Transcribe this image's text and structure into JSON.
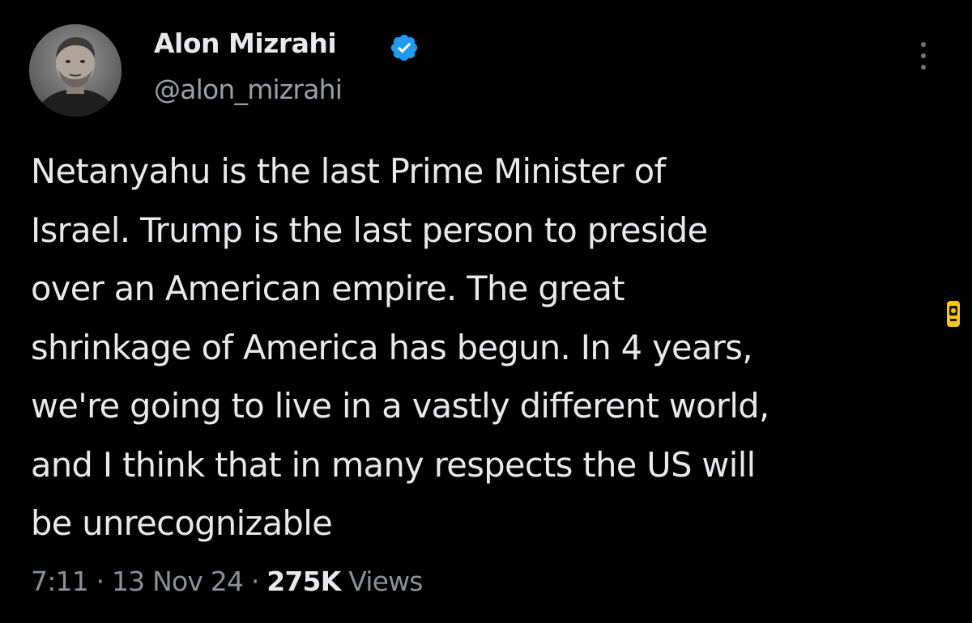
{
  "colors": {
    "background": "#000000",
    "text_primary": "#e7e9ea",
    "text_secondary": "#8b9096",
    "verified_badge": "#1d9bf0",
    "side_badge": "#f5c518"
  },
  "author": {
    "display_name": "Alon Mizrahi",
    "handle": "@alon_mizrahi",
    "avatar_icon": "profile-photo",
    "verified_icon": "verified-badge-icon"
  },
  "menu": {
    "icon": "more-vertical-icon"
  },
  "tweet": {
    "lines": [
      "Netanyahu is the last Prime Minister of",
      "Israel. Trump is the last person to preside",
      "over an American empire. The great",
      "shrinkage of America has begun. In 4 years,",
      "we're going to live in a vastly different world,",
      "and I think that in many respects the US will",
      "be unrecognizable"
    ]
  },
  "meta": {
    "time": "7:11",
    "separator": " · ",
    "date": "13 Nov 24",
    "views_count": "275K",
    "views_label": " Views"
  }
}
